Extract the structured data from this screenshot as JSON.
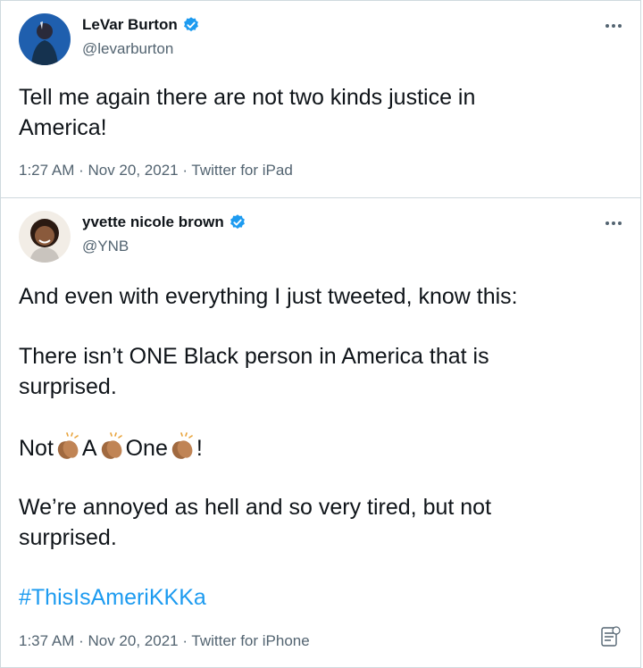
{
  "tweets": [
    {
      "author_name": "LeVar Burton",
      "handle": "@levarburton",
      "text_lines": [
        "Tell me again there are not two kinds justice in",
        "America!"
      ],
      "meta": "1:27 AM · Nov 20, 2021 · Twitter for iPad"
    },
    {
      "author_name": "yvette nicole brown",
      "handle": "@YNB",
      "p1": "And even with everything I just tweeted, know this:",
      "p2_lines": [
        "There isn’t ONE Black person in America that is",
        "surprised."
      ],
      "p3": {
        "w1": "Not",
        "w2": "A",
        "w3": "One",
        "w4": "!"
      },
      "p4_lines": [
        "We’re annoyed as hell and so very tired, but not",
        "surprised."
      ],
      "hashtag": "#ThisIsAmeriKKKa",
      "meta": "1:37 AM · Nov 20, 2021 · Twitter for iPhone"
    }
  ],
  "icons": {
    "verified": "verified-badge-icon",
    "more": "more-options-icon",
    "clap": "clapping-hands-emoji",
    "text_doc": "text-document-icon"
  },
  "colors": {
    "verified": "#1d9bf0",
    "hashtag": "#1d9bf0",
    "secondary_text": "#536471"
  }
}
